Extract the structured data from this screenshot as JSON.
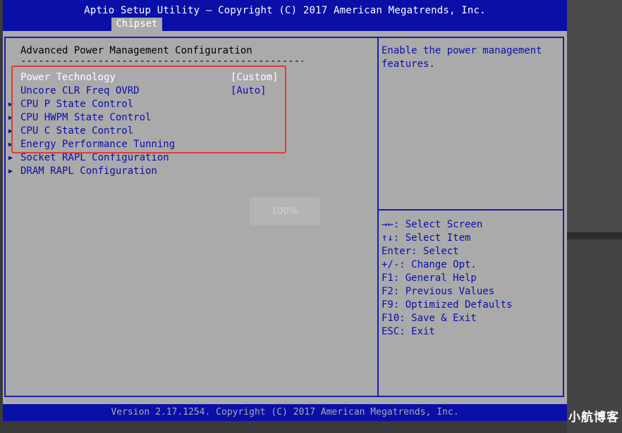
{
  "title_bar": {
    "title": "Aptio Setup Utility – Copyright (C) 2017 American Megatrends, Inc.",
    "active_tab": "Chipset"
  },
  "main": {
    "section_title": "Advanced Power Management Configuration",
    "separator": "----------------------------------------------------",
    "items": [
      {
        "label": "Power Technology",
        "value": "[Custom]",
        "submenu": false,
        "selected": true
      },
      {
        "label": "Uncore CLR Freq OVRD",
        "value": "[Auto]",
        "submenu": false,
        "selected": false
      },
      {
        "label": "CPU P State Control",
        "value": "",
        "submenu": true,
        "selected": false
      },
      {
        "label": "CPU HWPM State Control",
        "value": "",
        "submenu": true,
        "selected": false
      },
      {
        "label": "CPU C State Control",
        "value": "",
        "submenu": true,
        "selected": false
      },
      {
        "label": "Energy Performance Tunning",
        "value": "",
        "submenu": true,
        "selected": false
      },
      {
        "label": "Socket RAPL Configuration",
        "value": "",
        "submenu": true,
        "selected": false
      },
      {
        "label": "DRAM RAPL Configuration",
        "value": "",
        "submenu": true,
        "selected": false
      }
    ],
    "submenu_icon": "triangle-right-icon"
  },
  "help": {
    "text": "Enable the power management\nfeatures."
  },
  "keys": [
    "→←: Select Screen",
    "↑↓: Select Item",
    "Enter: Select",
    "+/-: Change Opt.",
    "F1: General Help",
    "F2: Previous Values",
    "F9: Optimized Defaults",
    "F10: Save & Exit",
    "ESC: Exit"
  ],
  "overlay": {
    "progress_label": "100%",
    "progress_value": 100
  },
  "footer": {
    "text": "Version 2.17.1254. Copyright (C) 2017 American Megatrends, Inc."
  },
  "watermark": "小航博客",
  "colors": {
    "bios_blue": "#0a0fa8",
    "bios_gray": "#aaaaaa",
    "selected_text": "#ffffff",
    "highlight_red": "#e53935"
  }
}
